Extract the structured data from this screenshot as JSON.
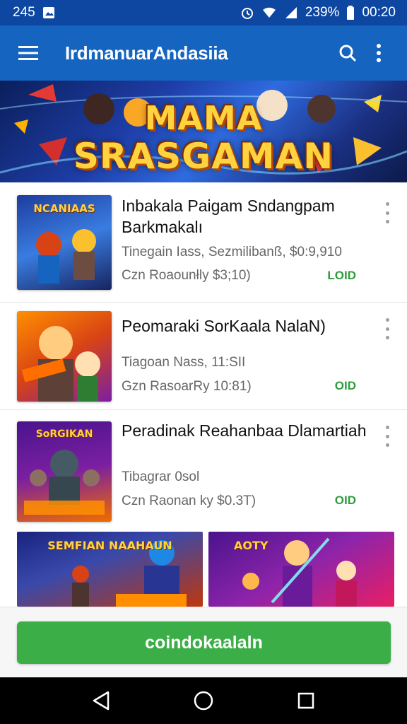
{
  "status_bar": {
    "time_left": "245",
    "battery": "239%",
    "time_right": "00:20"
  },
  "app_bar": {
    "title": "IrdmanuarAndasiia"
  },
  "banner": {
    "line1": "MAMA",
    "line2": "SRASGAMAN"
  },
  "items": [
    {
      "thumb_text": "NCANIAAS",
      "title": "Inbakala Paigam Sndangpam Barkmakalı",
      "meta1": "Tinegain Iass, Sezmilibanß, $0:9,910",
      "meta2": "Czn Roaounłly $3;10)",
      "badge": "LOID"
    },
    {
      "thumb_text": "",
      "title": "Peomaraki SorKaala NalaN)",
      "meta1": "Tiagoan Nass, 11:SII",
      "meta2": "Gzn RasoarRy 10:81)",
      "badge": "OID"
    },
    {
      "thumb_text": "SoRGIKAN",
      "title": "Peradinak Reahanbaa Dlamartiah",
      "meta1": "Tibagrar 0sol",
      "meta2": "Czn Raonan ky $0.3T)",
      "badge": "OID"
    }
  ],
  "grid": [
    {
      "text": "SEMFIAN NAAHAUN"
    },
    {
      "text": "AOTY"
    }
  ],
  "cta": {
    "label": "coindokaalaln"
  },
  "colors": {
    "status_bar": "#0d47a1",
    "app_bar": "#1565c0",
    "accent_green": "#3cae48",
    "badge_green": "#2e9d3e"
  }
}
